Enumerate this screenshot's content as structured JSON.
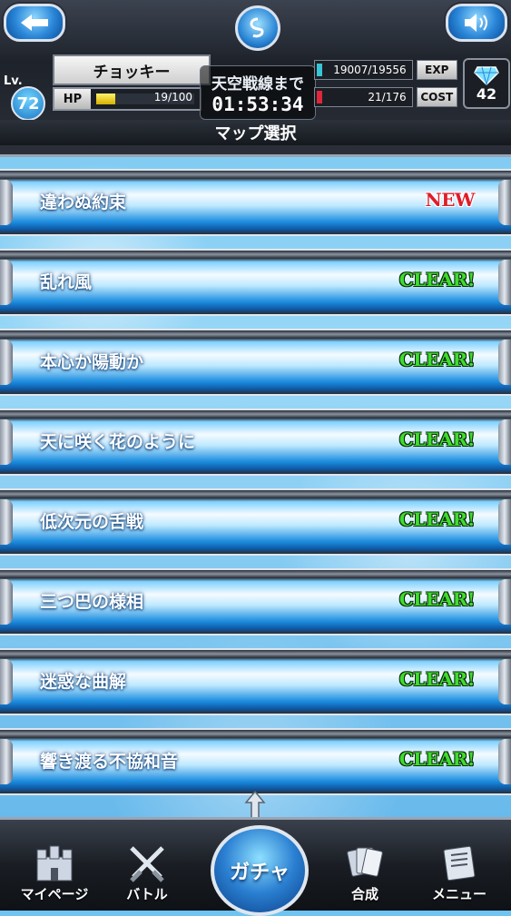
{
  "header": {
    "player_name": "チョッキー",
    "level_label": "Lv.",
    "level": "72",
    "hp_label": "HP",
    "hp_value": "19/100",
    "hp_fraction": 0.19,
    "timer_label": "天空戦線まで",
    "timer_value": "01:53:34",
    "exp_value": "19007/19556",
    "exp_label": "EXP",
    "cost_value": "21/176",
    "cost_label": "COST",
    "gems": "42",
    "section_title": "マップ選択"
  },
  "maps": [
    {
      "title": "違わぬ約束",
      "status": "NEW"
    },
    {
      "title": "乱れ風",
      "status": "CLEAR!"
    },
    {
      "title": "本心か陽動か",
      "status": "CLEAR!"
    },
    {
      "title": "天に咲く花のように",
      "status": "CLEAR!"
    },
    {
      "title": "低次元の舌戦",
      "status": "CLEAR!"
    },
    {
      "title": "三つ巴の様相",
      "status": "CLEAR!"
    },
    {
      "title": "迷惑な曲解",
      "status": "CLEAR!"
    },
    {
      "title": "響き渡る不協和音",
      "status": "CLEAR!"
    }
  ],
  "footer": {
    "mypage": "マイページ",
    "battle": "バトル",
    "gacha": "ガチャ",
    "fusion": "合成",
    "menu": "メニュー"
  },
  "colors": {
    "clear": "#3fdc2e",
    "new": "#e01c2a",
    "accent_blue": "#2a86d8"
  }
}
